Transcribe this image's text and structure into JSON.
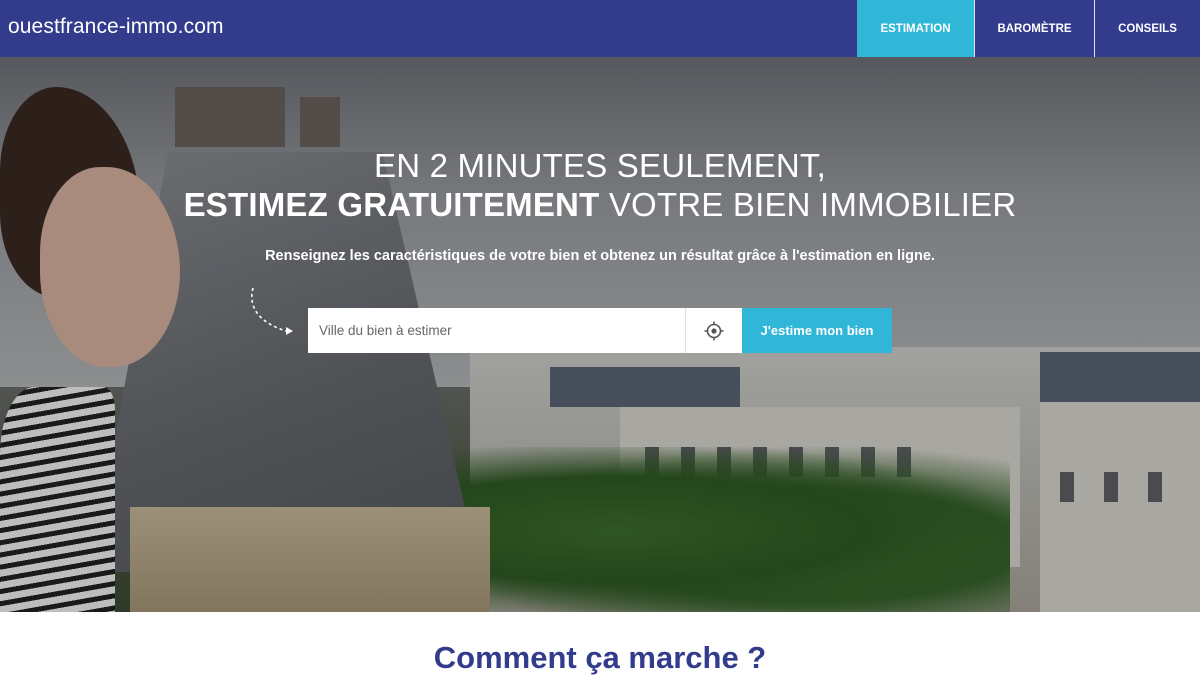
{
  "header": {
    "logo": "ouestfrance-immo.com",
    "nav": [
      {
        "label": "ESTIMATION",
        "active": true
      },
      {
        "label": "BAROMÈTRE",
        "active": false
      },
      {
        "label": "CONSEILS",
        "active": false
      }
    ]
  },
  "hero": {
    "line1": "EN 2 MINUTES SEULEMENT,",
    "line2_bold": "ESTIMEZ GRATUITEMENT",
    "line2_rest": " VOTRE BIEN IMMOBILIER",
    "subtitle": "Renseignez les caractéristiques de votre bien et obtenez un résultat grâce à l'estimation en ligne.",
    "search_placeholder": "Ville du bien à estimer",
    "geolocate_icon": "crosshair-icon",
    "cta_label": "J'estime mon bien"
  },
  "section": {
    "title": "Comment ça marche ?"
  },
  "colors": {
    "brand": "#323b8c",
    "accent": "#30b6d7"
  }
}
